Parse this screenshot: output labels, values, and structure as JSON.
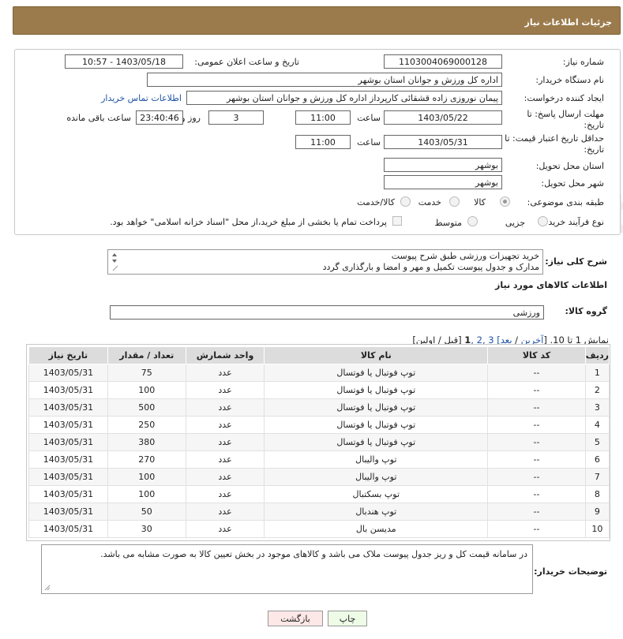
{
  "header": {
    "title": "جزئیات اطلاعات نیاز"
  },
  "form": {
    "need_number_label": "شماره نیاز:",
    "need_number": "1103004069000128",
    "announce_label": "تاریخ و ساعت اعلان عمومی:",
    "announce_value": "1403/05/18 - 10:57",
    "buyer_org_label": "نام دستگاه خریدار:",
    "buyer_org": "اداره کل ورزش و جوانان استان بوشهر",
    "creator_label": "ایجاد کننده درخواست:",
    "creator": "پیمان نوروزی زاده قشقائی کارپرداز اداره کل ورزش و جوانان استان بوشهر",
    "contact_link": "اطلاعات تماس خریدار",
    "reply_deadline_label": "مهلت ارسال پاسخ: تا تاریخ:",
    "reply_date": "1403/05/22",
    "time_label": "ساعت",
    "reply_time": "11:00",
    "days_value": "3",
    "days_label": "روز و",
    "remaining_value": "23:40:46",
    "remaining_label": "ساعت باقی مانده",
    "price_validity_label": "حداقل تاریخ اعتبار قیمت: تا تاریخ:",
    "validity_date": "1403/05/31",
    "validity_time": "11:00",
    "province_label": "استان محل تحویل:",
    "province": "بوشهر",
    "city_label": "شهر محل تحویل:",
    "city": "بوشهر",
    "category_label": "طبقه بندی موضوعی:",
    "category_options": [
      "کالا",
      "خدمت",
      "کالا/خدمت"
    ],
    "process_label": "نوع فرآیند خرید :",
    "process_options": [
      "جزیی",
      "متوسط"
    ],
    "payment_note": "پرداخت تمام یا بخشی از مبلغ خرید،از محل \"اسناد خزانه اسلامی\" خواهد بود."
  },
  "summary": {
    "label": "شرح کلی نیاز:",
    "line1": "خرید تجهیزات ورزشی طبق شرح پیوست",
    "line2": "مدارک و جدول پیوست تکمیل و مهر و امضا و بارگذاری گردد"
  },
  "goods": {
    "section_title": "اطلاعات کالاهای مورد نیاز",
    "group_label": "گروه کالا:",
    "group_value": "ورزشی",
    "pagination": {
      "prefix": "نمایش 1 تا 10. [",
      "last": "آخرین",
      "sep": " / ",
      "next": "بعد",
      "pages_tail": "] 3 ,2 ,",
      "current": "1",
      "suffix": " [قبل / اولین]"
    },
    "columns": [
      "ردیف",
      "کد کالا",
      "نام کالا",
      "واحد شمارش",
      "تعداد / مقدار",
      "تاریخ نیاز"
    ],
    "rows": [
      [
        "1",
        "--",
        "توپ فوتبال یا فوتسال",
        "عدد",
        "75",
        "1403/05/31"
      ],
      [
        "2",
        "--",
        "توپ فوتبال یا فوتسال",
        "عدد",
        "100",
        "1403/05/31"
      ],
      [
        "3",
        "--",
        "توپ فوتبال یا فوتسال",
        "عدد",
        "500",
        "1403/05/31"
      ],
      [
        "4",
        "--",
        "توپ فوتبال یا فوتسال",
        "عدد",
        "250",
        "1403/05/31"
      ],
      [
        "5",
        "--",
        "توپ فوتبال یا فوتسال",
        "عدد",
        "380",
        "1403/05/31"
      ],
      [
        "6",
        "--",
        "توپ والیبال",
        "عدد",
        "270",
        "1403/05/31"
      ],
      [
        "7",
        "--",
        "توپ والیبال",
        "عدد",
        "100",
        "1403/05/31"
      ],
      [
        "8",
        "--",
        "توپ بسکتبال",
        "عدد",
        "100",
        "1403/05/31"
      ],
      [
        "9",
        "--",
        "توپ هندبال",
        "عدد",
        "50",
        "1403/05/31"
      ],
      [
        "10",
        "--",
        "مدیسن بال",
        "عدد",
        "30",
        "1403/05/31"
      ]
    ]
  },
  "notes": {
    "label": "توضیحات خریدار:",
    "text": "در سامانه قیمت کل و ریز جدول پیوست ملاک می باشد و کالاهای موجود در بخش تعیین کالا به صورت مشابه می باشد."
  },
  "buttons": {
    "print": "چاپ",
    "back": "بازگشت"
  },
  "watermark": "AriaTender.net",
  "colors": {
    "header": "#9b7b4c",
    "link": "#1f53a8",
    "print_bg": "#eefbe6",
    "back_bg": "#fde7e7"
  }
}
